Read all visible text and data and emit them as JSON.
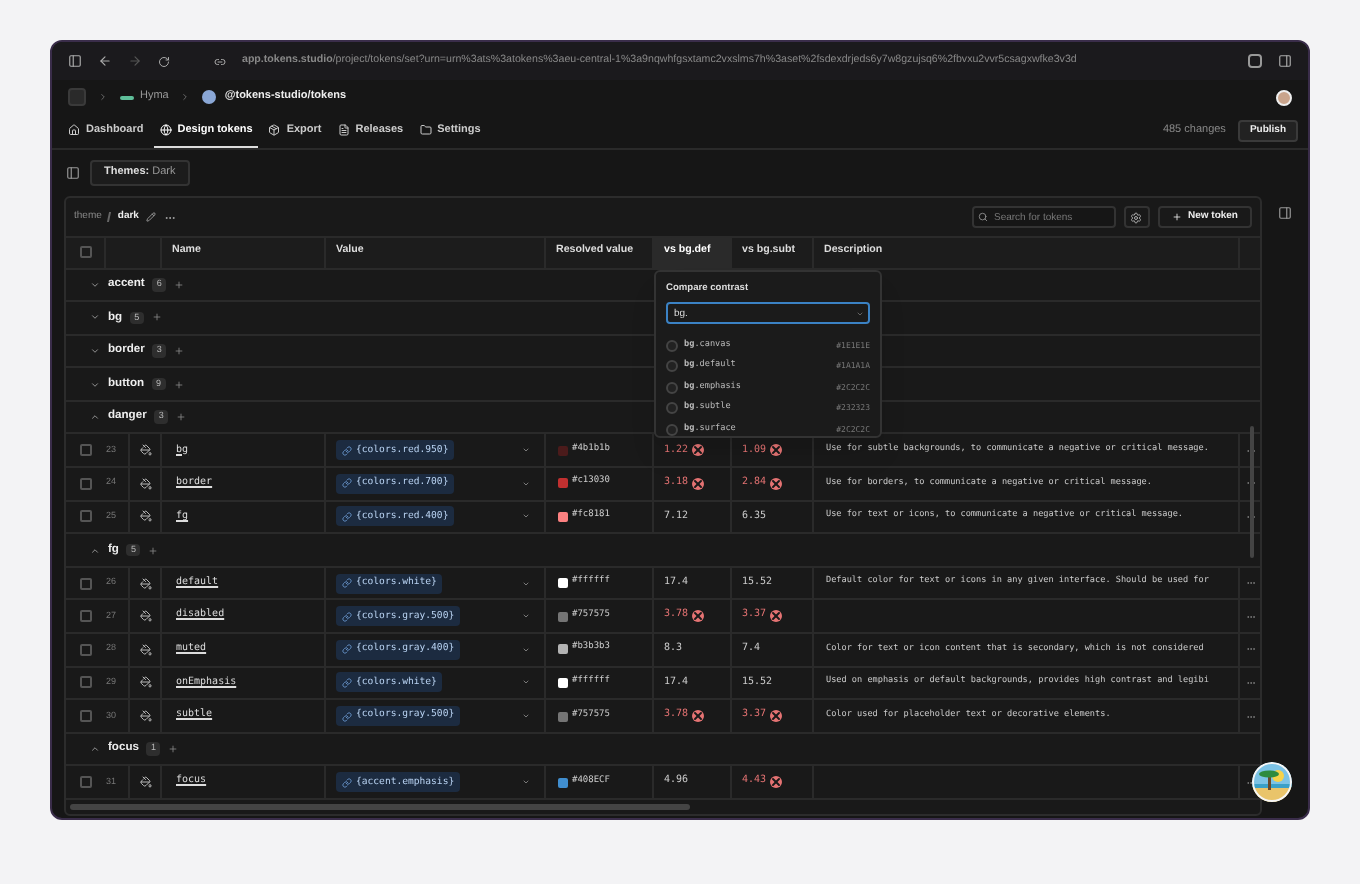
{
  "browser": {
    "url": "**app.tokens.studio**/project/tokens/set?urn=urn%3ats%3atokens%3aeu-central-1%3a9nqwhfgsxtamc2vxslms7h%3aset%2fsdexdrjeds6y7w8gzujsq6%2fbvxu2vvr5csagxwfke3v3d"
  },
  "breadcrumb": [
    "Hyma",
    "@tokens-studio/tokens"
  ],
  "nav_tabs": [
    {
      "label": "Dashboard",
      "selected": false
    },
    {
      "label": "Design tokens",
      "selected": true
    },
    {
      "label": "Export",
      "selected": false
    },
    {
      "label": "Releases",
      "selected": false
    },
    {
      "label": "Settings",
      "selected": false
    }
  ],
  "changes": "485 changes",
  "publish": "Publish",
  "themes": {
    "label": "Themes:",
    "value": "Dark"
  },
  "path": [
    "theme",
    "dark"
  ],
  "search": {
    "placeholder": "Search for tokens"
  },
  "new_token": "New token",
  "table": {
    "header_checked": false,
    "columns": [
      {
        "label": "Name",
        "selected": false
      },
      {
        "label": "Value",
        "selected": false
      },
      {
        "label": "Resolved value",
        "selected": false
      },
      {
        "label": "vs bg.def",
        "selected": true
      },
      {
        "label": "vs bg.subt",
        "selected": false
      },
      {
        "label": "Description",
        "selected": false
      }
    ],
    "groups": [
      {
        "name": "accent",
        "count": "6",
        "expanded": false
      },
      {
        "name": "bg",
        "count": "5",
        "expanded": false
      },
      {
        "name": "border",
        "count": "3",
        "expanded": false
      },
      {
        "name": "button",
        "count": "9",
        "expanded": false
      },
      {
        "name": "danger",
        "count": "3",
        "expanded": true,
        "tokens": [
          {
            "number": "23",
            "checked": false,
            "name": "bg",
            "value": "{colors.red.950}",
            "resolved": "#4b1b1b",
            "color": "#4b1b1b",
            "vs_def": {
              "text": "1.22",
              "fails": true
            },
            "vs_subt": {
              "text": "1.09",
              "fails": true
            },
            "description": "Use for subtle backgrounds, to communicate a negative or critical message."
          },
          {
            "number": "24",
            "checked": false,
            "name": "border",
            "value": "{colors.red.700}",
            "resolved": "#c13030",
            "color": "#c13030",
            "vs_def": {
              "text": "3.18",
              "fails": true
            },
            "vs_subt": {
              "text": "2.84",
              "fails": true
            },
            "description": "Use for borders, to communicate a negative or critical message."
          },
          {
            "number": "25",
            "checked": false,
            "name": "fg",
            "value": "{colors.red.400}",
            "resolved": "#fc8181",
            "color": "#fc8181",
            "vs_def": {
              "text": "7.12",
              "fails": false
            },
            "vs_subt": {
              "text": "6.35",
              "fails": false
            },
            "description": "Use for text or icons, to communicate a negative or critical message."
          }
        ]
      },
      {
        "name": "fg",
        "count": "5",
        "expanded": true,
        "tokens": [
          {
            "number": "26",
            "checked": false,
            "name": "default",
            "value": "{colors.white}",
            "resolved": "#ffffff",
            "color": "#ffffff",
            "vs_def": {
              "text": "17.4",
              "fails": false
            },
            "vs_subt": {
              "text": "15.52",
              "fails": false
            },
            "description": "Default color for text or icons in any given interface. Should be used for"
          },
          {
            "number": "27",
            "checked": false,
            "name": "disabled",
            "value": "{colors.gray.500}",
            "resolved": "#757575",
            "color": "#757575",
            "vs_def": {
              "text": "3.78",
              "fails": true
            },
            "vs_subt": {
              "text": "3.37",
              "fails": true
            }
          },
          {
            "number": "28",
            "checked": false,
            "name": "muted",
            "value": "{colors.gray.400}",
            "resolved": "#b3b3b3",
            "color": "#b3b3b3",
            "vs_def": {
              "text": "8.3",
              "fails": false
            },
            "vs_subt": {
              "text": "7.4",
              "fails": false
            },
            "description": "Color for text or icon content that is secondary, which is not considered"
          },
          {
            "number": "29",
            "checked": false,
            "name": "onEmphasis",
            "value": "{colors.white}",
            "resolved": "#ffffff",
            "color": "#ffffff",
            "vs_def": {
              "text": "17.4",
              "fails": false
            },
            "vs_subt": {
              "text": "15.52",
              "fails": false
            },
            "description": "Used on emphasis or default backgrounds, provides high contrast and legibi"
          },
          {
            "number": "30",
            "checked": false,
            "name": "subtle",
            "value": "{colors.gray.500}",
            "resolved": "#757575",
            "color": "#757575",
            "vs_def": {
              "text": "3.78",
              "fails": true
            },
            "vs_subt": {
              "text": "3.37",
              "fails": true
            },
            "description": "Color used for placeholder text or decorative elements."
          }
        ]
      },
      {
        "name": "focus",
        "count": "1",
        "expanded": true,
        "tokens": [
          {
            "number": "31",
            "checked": false,
            "name": "focus",
            "value": "{accent.emphasis}",
            "resolved": "#408ECF",
            "color": "#408ecf",
            "vs_def": {
              "text": "4.96",
              "fails": false
            },
            "vs_subt": {
              "text": "4.43",
              "fails": true
            }
          }
        ]
      }
    ]
  },
  "compare": {
    "title": "Compare contrast",
    "query": "bg.",
    "options": [
      {
        "label": "**bg**.canvas",
        "hex": "#1E1E1E",
        "selected": false
      },
      {
        "label": "**bg**.default",
        "hex": "#1A1A1A",
        "selected": false
      },
      {
        "label": "**bg**.emphasis",
        "hex": "#2C2C2C",
        "selected": false
      },
      {
        "label": "**bg**.subtle",
        "hex": "#232323",
        "selected": false
      },
      {
        "label": "**bg**.surface",
        "hex": "#2C2C2C",
        "selected": false
      }
    ]
  }
}
